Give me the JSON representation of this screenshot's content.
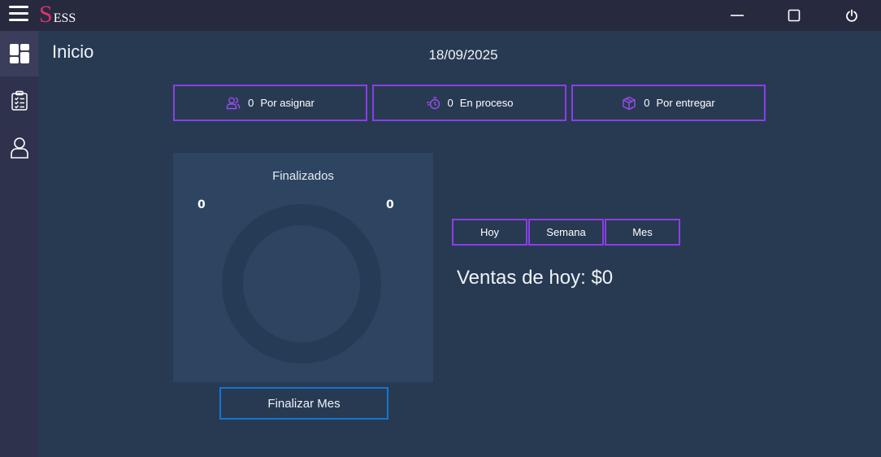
{
  "app": {
    "logo_initial": "S",
    "logo_rest": "ESS",
    "window_controls": [
      "minimize-icon",
      "maximize-icon",
      "power-icon"
    ]
  },
  "sidebar": {
    "items": [
      {
        "icon": "dashboard-icon",
        "active": true
      },
      {
        "icon": "clipboard-icon",
        "active": false
      },
      {
        "icon": "user-icon",
        "active": false
      }
    ]
  },
  "header": {
    "title": "Inicio",
    "date": "18/09/2025"
  },
  "stats": [
    {
      "icon": "users-icon",
      "count": "0",
      "label": "Por asignar"
    },
    {
      "icon": "timer-icon",
      "count": "0",
      "label": "En proceso"
    },
    {
      "icon": "box-icon",
      "count": "0",
      "label": "Por entregar"
    }
  ],
  "finalizados": {
    "title": "Finalizados",
    "left_count": "0",
    "right_count": "0",
    "finalize_button": "Finalizar Mes"
  },
  "period_tabs": [
    "Hoy",
    "Semana",
    "Mes"
  ],
  "sales": {
    "text": "Ventas de hoy: $0"
  },
  "colors": {
    "accent": "#8b3ee6",
    "logo": "#d8336c",
    "button_border": "#1674d0",
    "background": "#283a52",
    "sidebar": "#2f324c",
    "titlebar": "#272a3e"
  }
}
